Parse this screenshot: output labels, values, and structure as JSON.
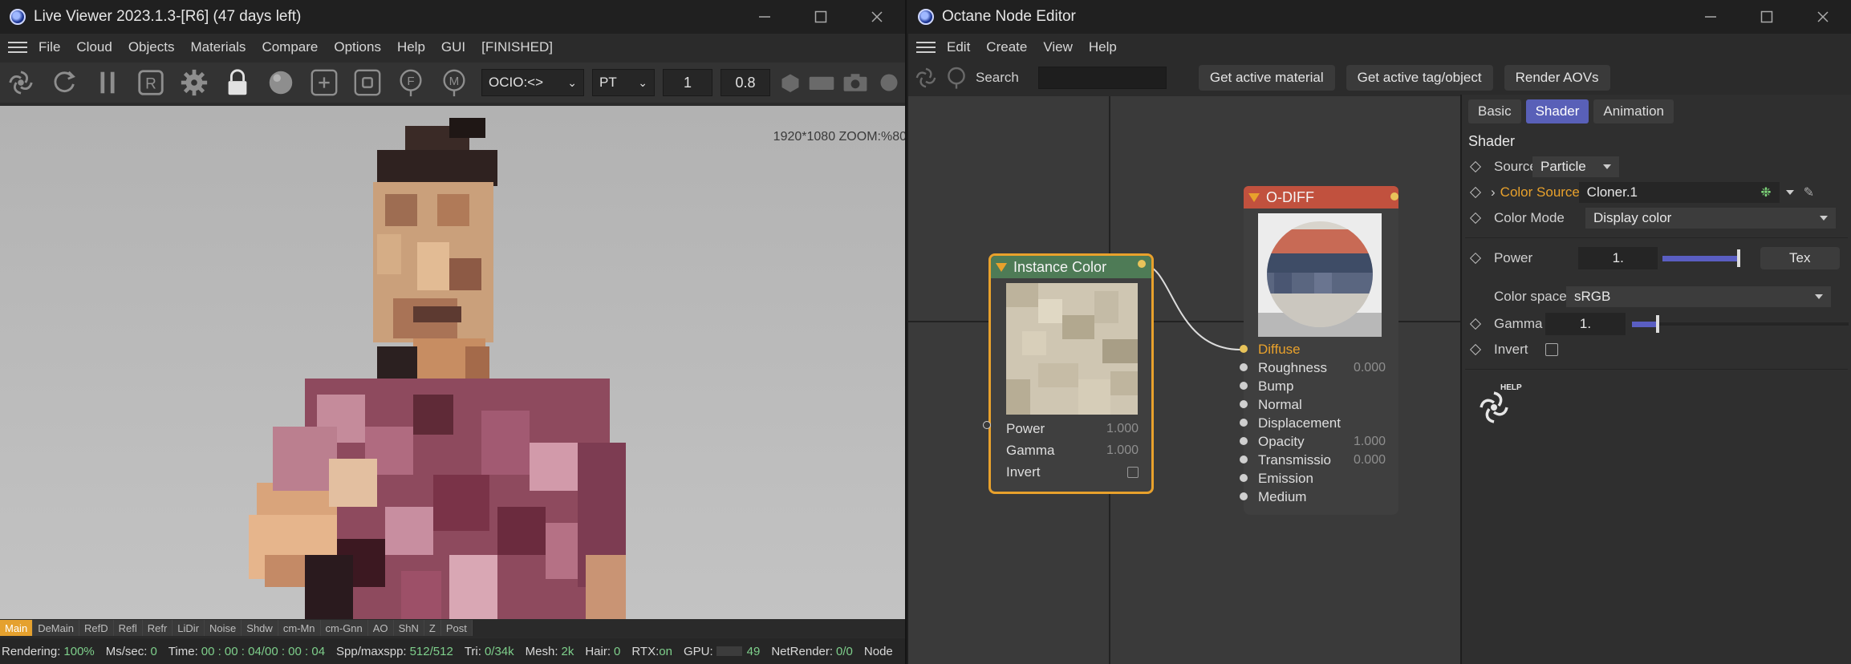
{
  "live_viewer": {
    "title": "Live Viewer 2023.1.3-[R6] (47 days left)",
    "menu": [
      "File",
      "Cloud",
      "Objects",
      "Materials",
      "Compare",
      "Options",
      "Help",
      "GUI",
      "[FINISHED]"
    ],
    "toolbar": {
      "icons": [
        "octane-logo-icon",
        "refresh-icon",
        "pause-icon",
        "region-render-icon",
        "settings-gear-icon",
        "lock-icon",
        "material-ball-icon",
        "add-region-icon",
        "film-region-icon",
        "focus-picker-icon",
        "material-picker-icon"
      ],
      "ocio": "OCIO:<>",
      "kernel": "PT",
      "value1": "1",
      "value2": "0.8"
    },
    "zoom_label": "1920*1080 ZOOM:%80",
    "passes": [
      "Main",
      "DeMain",
      "RefD",
      "Refl",
      "Refr",
      "LiDir",
      "Noise",
      "Shdw",
      "cm-Mn",
      "cm-Gnn",
      "AO",
      "ShN",
      "Z",
      "Post"
    ],
    "active_pass": "Main",
    "status": {
      "rendering_label": "Rendering:",
      "rendering_value": "100%",
      "ms_label": "Ms/sec:",
      "ms_value": "0",
      "time_label": "Time:",
      "time_value": "00 : 00 : 04/00 : 00 : 04",
      "spp_label": "Spp/maxspp:",
      "spp_value": "512/512",
      "tri_label": "Tri:",
      "tri_value": "0/34k",
      "mesh_label": "Mesh:",
      "mesh_value": "2k",
      "hair_label": "Hair:",
      "hair_value": "0",
      "rtx_label": "RTX:",
      "rtx_value": "on",
      "gpu_label": "GPU:",
      "gpu_value": "49",
      "net_label": "NetRender:",
      "net_value": "0/0",
      "node_label": "Node"
    }
  },
  "node_editor": {
    "title": "Octane Node Editor",
    "menu": [
      "Edit",
      "Create",
      "View",
      "Help"
    ],
    "search_label": "Search",
    "buttons": [
      "Get active material",
      "Get active tag/object",
      "Render AOVs"
    ],
    "instance_node": {
      "title": "Instance Color",
      "power_label": "Power",
      "power_value": "1.000",
      "gamma_label": "Gamma",
      "gamma_value": "1.000",
      "invert_label": "Invert",
      "head_color": "#4e7b56"
    },
    "diff_node": {
      "title": "O-DIFF",
      "head_color": "#c1513e",
      "pins": [
        {
          "label": "Diffuse",
          "value": ""
        },
        {
          "label": "Roughness",
          "value": "0.000"
        },
        {
          "label": "Bump",
          "value": ""
        },
        {
          "label": "Normal",
          "value": ""
        },
        {
          "label": "Displacement",
          "value": ""
        },
        {
          "label": "Opacity",
          "value": "1.000"
        },
        {
          "label": "Transmissio",
          "value": "0.000"
        },
        {
          "label": "Emission",
          "value": ""
        },
        {
          "label": "Medium",
          "value": ""
        }
      ]
    },
    "props": {
      "tabs": [
        "Basic",
        "Shader",
        "Animation"
      ],
      "active_tab": "Shader",
      "section": "Shader",
      "source_label": "Source",
      "source_value": "Particle",
      "color_source_label": "Color Source",
      "color_source_value": "Cloner.1",
      "color_mode_label": "Color Mode",
      "color_mode_value": "Display color",
      "power_label": "Power",
      "power_value": "1.",
      "power_fraction": 0.95,
      "tex_button": "Tex",
      "color_space_label": "Color space",
      "color_space_value": "sRGB",
      "gamma_label": "Gamma",
      "gamma_value": "1.",
      "gamma_fraction": 0.12,
      "invert_label": "Invert",
      "help_label": "HELP"
    },
    "accent": "#e8a12c",
    "slider_color": "#5a5ec2"
  }
}
